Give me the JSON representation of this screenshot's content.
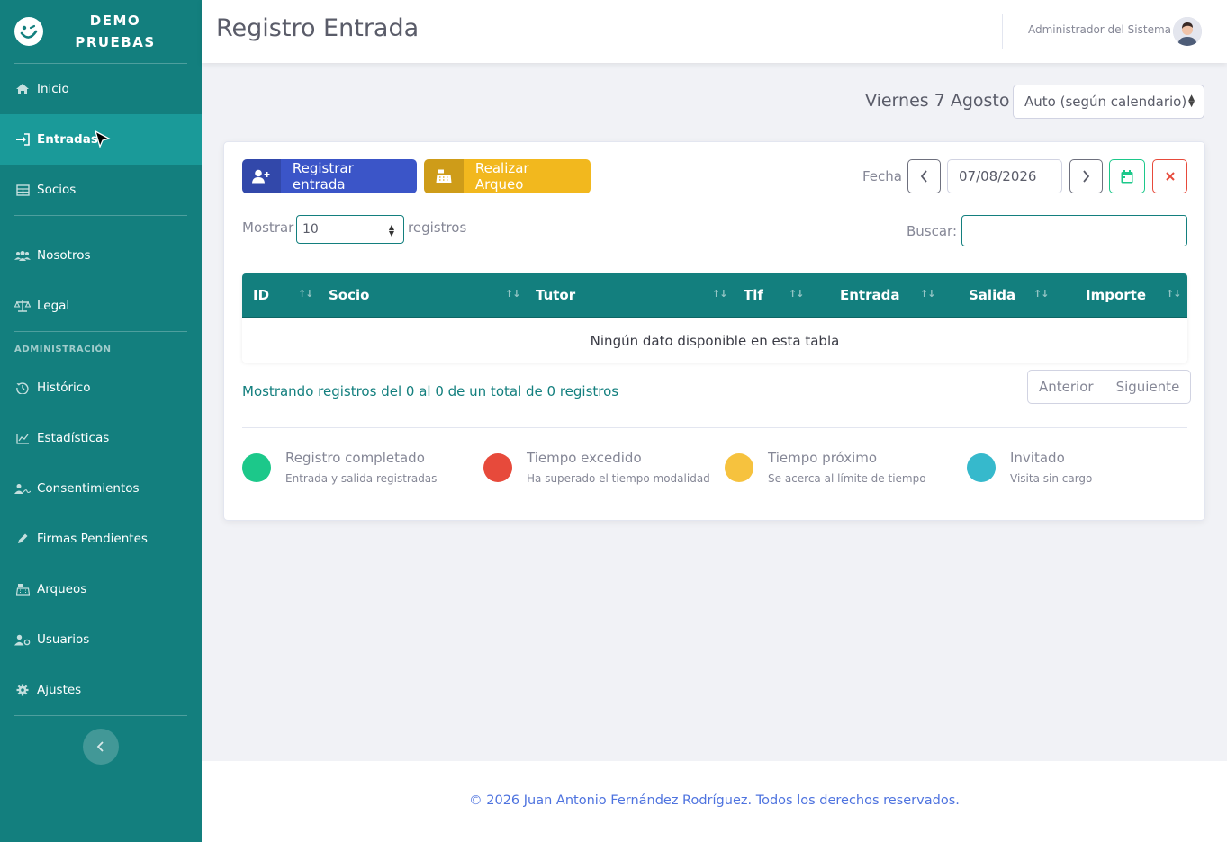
{
  "brand": {
    "line1": "DEMO",
    "line2": "PRUEBAS"
  },
  "sidebar": {
    "items": [
      {
        "label": "Inicio",
        "icon": "home-icon"
      },
      {
        "label": "Entradas",
        "icon": "sign-in-icon",
        "active": true
      },
      {
        "label": "Socios",
        "icon": "table-icon"
      },
      {
        "label": "Nosotros",
        "icon": "users-icon"
      },
      {
        "label": "Legal",
        "icon": "balance-scale-icon"
      }
    ],
    "heading": "ADMINISTRACIÓN",
    "admin_items": [
      {
        "label": "Histórico",
        "icon": "history-icon"
      },
      {
        "label": "Estadísticas",
        "icon": "line-chart-icon"
      },
      {
        "label": "Consentimientos",
        "icon": "user-signature-icon"
      },
      {
        "label": "Firmas Pendientes",
        "icon": "pen-icon"
      },
      {
        "label": "Arqueos",
        "icon": "cash-register-icon"
      },
      {
        "label": "Usuarios",
        "icon": "user-cog-icon"
      },
      {
        "label": "Ajustes",
        "icon": "gear-icon"
      }
    ]
  },
  "topbar": {
    "title": "Registro Entrada",
    "user": "Administrador del Sistema"
  },
  "header": {
    "date_label": "Viernes 7 Agosto",
    "mode_selected": "Auto (según calendario)"
  },
  "actions": {
    "register": "Registrar entrada",
    "arqueo": "Realizar Arqueo"
  },
  "filters": {
    "fecha_label": "Fecha",
    "fecha_value": "07/08/2026",
    "show_prefix": "Mostrar",
    "show_value": "10",
    "show_suffix": "registros",
    "search_label": "Buscar:"
  },
  "table": {
    "columns": [
      "ID",
      "Socio",
      "Tutor",
      "Tlf",
      "Entrada",
      "Salida",
      "Importe"
    ],
    "empty": "Ningún dato disponible en esta tabla",
    "sort_glyph": "↑↓"
  },
  "pagination": {
    "info": "Mostrando registros del 0 al 0 de un total de 0 registros",
    "prev": "Anterior",
    "next": "Siguiente"
  },
  "legend": [
    {
      "title": "Registro completado",
      "subtitle": "Entrada y salida registradas",
      "color": "#1cc88a"
    },
    {
      "title": "Tiempo excedido",
      "subtitle": "Ha superado el tiempo modalidad",
      "color": "#e74a3b"
    },
    {
      "title": "Tiempo próximo",
      "subtitle": "Se acerca al límite de tiempo",
      "color": "#f6c23e"
    },
    {
      "title": "Invitado",
      "subtitle": "Visita sin cargo",
      "color": "#36b9cc"
    }
  ],
  "footer": {
    "text": "© 2026 Juan Antonio Fernández Rodríguez. Todos los derechos reservados."
  },
  "colors": {
    "sidebar": "#137f7e",
    "active": "#1a9a99",
    "primary": "#3b55c8",
    "warning": "#f2b81e"
  }
}
